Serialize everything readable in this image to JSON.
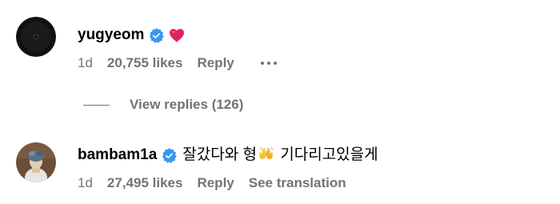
{
  "comments": [
    {
      "username": "yugyeom",
      "verified": true,
      "text": "",
      "emoji": "red-heart",
      "time": "1d",
      "likes": "20,755 likes",
      "reply_label": "Reply",
      "more_icon": "more-options-icon",
      "view_replies": "View replies (126)"
    },
    {
      "username": "bambam1a",
      "verified": true,
      "text_before": "잘갔다와 형",
      "emoji": "raising-hands",
      "text_after": " 기다리고있을게",
      "time": "1d",
      "likes": "27,495 likes",
      "reply_label": "Reply",
      "translation_label": "See translation"
    }
  ],
  "colors": {
    "verified_blue": "#3897f0",
    "meta_gray": "#737373",
    "heart_red": "#e0245e"
  }
}
